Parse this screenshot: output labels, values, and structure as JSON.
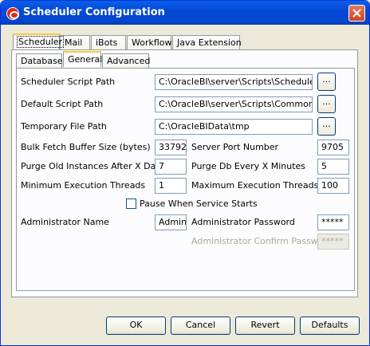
{
  "window": {
    "title": "Scheduler Configuration"
  },
  "outer_tabs": [
    {
      "label": "Scheduler",
      "active": true
    },
    {
      "label": "Mail",
      "active": false
    },
    {
      "label": "iBots",
      "active": false
    },
    {
      "label": "Workflow",
      "active": false
    },
    {
      "label": "Java Extension",
      "active": false
    }
  ],
  "inner_tabs": [
    {
      "label": "Database",
      "active": false
    },
    {
      "label": "General",
      "active": true
    },
    {
      "label": "Advanced",
      "active": false
    }
  ],
  "general": {
    "scheduler_script_path": {
      "label": "Scheduler Script Path",
      "value": "C:\\OracleBI\\server\\Scripts\\Scheduler",
      "browse": "..."
    },
    "default_script_path": {
      "label": "Default Script Path",
      "value": "C:\\OracleBI\\server\\Scripts\\Common",
      "browse": "..."
    },
    "temporary_file_path": {
      "label": "Temporary File Path",
      "value": "C:\\OracleBIData\\tmp",
      "browse": "..."
    },
    "bulk_fetch_buffer_size": {
      "label": "Bulk Fetch Buffer Size (bytes)",
      "value": "33792"
    },
    "server_port_number": {
      "label": "Server Port Number",
      "value": "9705"
    },
    "purge_old_instances": {
      "label": "Purge Old Instances After X Days",
      "value": "7"
    },
    "purge_db_every": {
      "label": "Purge Db Every X Minutes",
      "value": "5"
    },
    "min_execution_threads": {
      "label": "Minimum Execution Threads",
      "value": "1"
    },
    "max_execution_threads": {
      "label": "Maximum Execution Threads",
      "value": "100"
    },
    "pause_when_service_starts": {
      "label": "Pause When Service Starts",
      "checked": false
    },
    "administrator_name": {
      "label": "Administrator Name",
      "value": "Admini"
    },
    "administrator_password": {
      "label": "Administrator Password",
      "value": "*****"
    },
    "administrator_confirm_password": {
      "label": "Administrator Confirm Password",
      "value": "*****"
    }
  },
  "buttons": {
    "ok": "OK",
    "cancel": "Cancel",
    "revert": "Revert",
    "defaults": "Defaults"
  },
  "icons": {
    "app": "oracle-logo-icon",
    "close": "close-icon"
  },
  "colors": {
    "titlebar": "#0449d6",
    "tab_highlight": "#ffc83c",
    "close_button": "#d1451f"
  }
}
